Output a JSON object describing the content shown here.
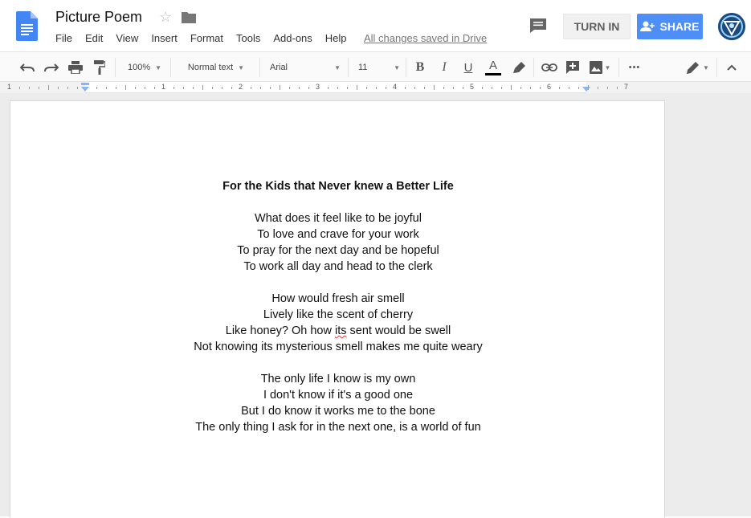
{
  "header": {
    "doc_title": "Picture Poem",
    "saved_status": "All changes saved in Drive",
    "turn_in_label": "TURN IN",
    "share_label": "SHARE"
  },
  "menu": [
    "File",
    "Edit",
    "View",
    "Insert",
    "Format",
    "Tools",
    "Add-ons",
    "Help"
  ],
  "toolbar": {
    "zoom": "100%",
    "style": "Normal text",
    "font": "Arial",
    "font_size": "11",
    "more": "•••"
  },
  "ruler": {
    "numbers": [
      "1",
      "1",
      "2",
      "3",
      "4",
      "5",
      "6",
      "7"
    ]
  },
  "colors": {
    "accent_blue": "#4d8ef7",
    "doc_icon_blue": "#4285f4",
    "text_color_bar": "#000000",
    "spellcheck_red": "#e53935"
  },
  "icons": [
    "docs-logo-icon",
    "star-icon",
    "folder-icon",
    "comment-icon",
    "add-person-icon",
    "avatar-icon",
    "undo-icon",
    "redo-icon",
    "print-icon",
    "paint-format-icon",
    "bold-icon",
    "italic-icon",
    "underline-icon",
    "text-color-icon",
    "highlight-icon",
    "link-icon",
    "insert-comment-icon",
    "image-icon",
    "pencil-icon",
    "collapse-icon"
  ],
  "document": {
    "title": "For the Kids that Never knew a Better Life",
    "stanza1": [
      "What does it feel like to be joyful",
      "To love and crave for your work",
      "To pray for the next day and be hopeful",
      "To work all day and head to the clerk"
    ],
    "stanza2": {
      "line1": "How would fresh air smell",
      "line2": "Lively like the scent of cherry",
      "line3_pre": "Like honey? Oh how ",
      "line3_err": "its",
      "line3_post": " sent would be swell",
      "line4": "Not knowing its mysterious smell makes me quite weary"
    },
    "stanza3": [
      "The only life I know is my own",
      "I don't know if it's a good one",
      "But I do know it works me to the bone",
      "The only thing I ask for in the next one, is a world of fun"
    ]
  }
}
